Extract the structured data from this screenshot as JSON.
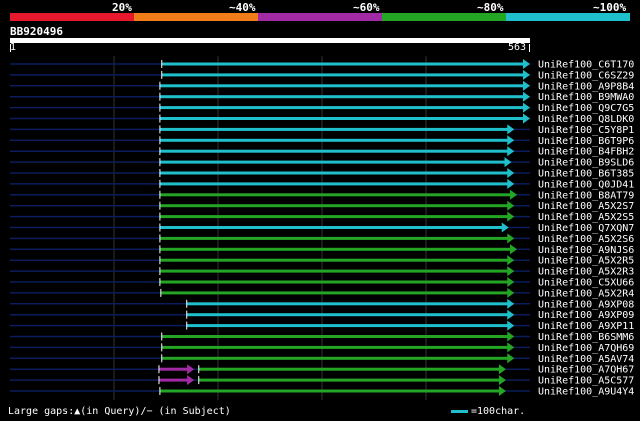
{
  "header": {
    "percent_labels": [
      "20%",
      "~40%",
      "~60%",
      "~80%",
      "~100%"
    ],
    "colors": [
      "#e8192c",
      "#f07d1a",
      "#a32aa5",
      "#24a524",
      "#1fc0cc"
    ]
  },
  "query": {
    "name": "BB920496",
    "start": "1",
    "end": "563",
    "length": 563
  },
  "hits": [
    {
      "label": "UniRef100_C6T170",
      "segments": [
        {
          "start": 165,
          "end": 563,
          "color": "cyan"
        }
      ]
    },
    {
      "label": "UniRef100_C6SZ29",
      "segments": [
        {
          "start": 165,
          "end": 563,
          "color": "cyan"
        }
      ]
    },
    {
      "label": "UniRef100_A9P8B4",
      "segments": [
        {
          "start": 163,
          "end": 563,
          "color": "cyan"
        }
      ]
    },
    {
      "label": "UniRef100_B9MWA0",
      "segments": [
        {
          "start": 163,
          "end": 563,
          "color": "cyan"
        }
      ]
    },
    {
      "label": "UniRef100_Q9C7G5",
      "segments": [
        {
          "start": 163,
          "end": 563,
          "color": "cyan"
        }
      ]
    },
    {
      "label": "UniRef100_Q8LDK0",
      "segments": [
        {
          "start": 163,
          "end": 563,
          "color": "cyan"
        }
      ]
    },
    {
      "label": "UniRef100_C5Y8P1",
      "segments": [
        {
          "start": 163,
          "end": 546,
          "color": "cyan"
        }
      ]
    },
    {
      "label": "UniRef100_B6T9P6",
      "segments": [
        {
          "start": 163,
          "end": 546,
          "color": "cyan"
        }
      ]
    },
    {
      "label": "UniRef100_B4FBH2",
      "segments": [
        {
          "start": 163,
          "end": 546,
          "color": "cyan"
        }
      ]
    },
    {
      "label": "UniRef100_B9SLD6",
      "segments": [
        {
          "start": 163,
          "end": 543,
          "color": "cyan"
        }
      ]
    },
    {
      "label": "UniRef100_B6T385",
      "segments": [
        {
          "start": 163,
          "end": 546,
          "color": "cyan"
        }
      ]
    },
    {
      "label": "UniRef100_Q0JD41",
      "segments": [
        {
          "start": 163,
          "end": 546,
          "color": "cyan"
        }
      ]
    },
    {
      "label": "UniRef100_B8AT79",
      "segments": [
        {
          "start": 163,
          "end": 549,
          "color": "green"
        }
      ]
    },
    {
      "label": "UniRef100_A5X2S7",
      "segments": [
        {
          "start": 163,
          "end": 546,
          "color": "green"
        }
      ]
    },
    {
      "label": "UniRef100_A5X2S5",
      "segments": [
        {
          "start": 163,
          "end": 546,
          "color": "green"
        }
      ]
    },
    {
      "label": "UniRef100_Q7XQN7",
      "segments": [
        {
          "start": 163,
          "end": 540,
          "color": "cyan"
        }
      ]
    },
    {
      "label": "UniRef100_A5X2S6",
      "segments": [
        {
          "start": 163,
          "end": 546,
          "color": "green"
        }
      ]
    },
    {
      "label": "UniRef100_A9NJS6",
      "segments": [
        {
          "start": 163,
          "end": 549,
          "color": "green"
        }
      ]
    },
    {
      "label": "UniRef100_A5X2R5",
      "segments": [
        {
          "start": 163,
          "end": 546,
          "color": "green"
        }
      ]
    },
    {
      "label": "UniRef100_A5X2R3",
      "segments": [
        {
          "start": 163,
          "end": 546,
          "color": "green"
        }
      ]
    },
    {
      "label": "UniRef100_C5XU66",
      "segments": [
        {
          "start": 163,
          "end": 546,
          "color": "green"
        }
      ]
    },
    {
      "label": "UniRef100_A5X2R4",
      "segments": [
        {
          "start": 164,
          "end": 546,
          "color": "green"
        }
      ]
    },
    {
      "label": "UniRef100_A9XP08",
      "segments": [
        {
          "start": 192,
          "end": 546,
          "color": "cyan"
        }
      ]
    },
    {
      "label": "UniRef100_A9XP09",
      "segments": [
        {
          "start": 192,
          "end": 546,
          "color": "cyan"
        }
      ]
    },
    {
      "label": "UniRef100_A9XP11",
      "segments": [
        {
          "start": 192,
          "end": 546,
          "color": "cyan"
        }
      ]
    },
    {
      "label": "UniRef100_B6SMM6",
      "segments": [
        {
          "start": 165,
          "end": 546,
          "color": "green"
        }
      ]
    },
    {
      "label": "UniRef100_A7QH69",
      "segments": [
        {
          "start": 165,
          "end": 546,
          "color": "green"
        }
      ]
    },
    {
      "label": "UniRef100_A5AV74",
      "segments": [
        {
          "start": 165,
          "end": 546,
          "color": "green"
        }
      ]
    },
    {
      "label": "UniRef100_A7QH67",
      "segments": [
        {
          "start": 162,
          "end": 200,
          "color": "purple"
        },
        {
          "start": 205,
          "end": 537,
          "color": "green"
        }
      ]
    },
    {
      "label": "UniRef100_A5C577",
      "segments": [
        {
          "start": 162,
          "end": 200,
          "color": "purple"
        },
        {
          "start": 205,
          "end": 537,
          "color": "green"
        }
      ]
    },
    {
      "label": "UniRef100_A9U4Y4",
      "segments": [
        {
          "start": 163,
          "end": 537,
          "color": "green"
        }
      ]
    }
  ],
  "legend": {
    "gaps_text": "Large gaps:▲(in Query)/− (in Subject)",
    "unit_text": "=100char."
  }
}
